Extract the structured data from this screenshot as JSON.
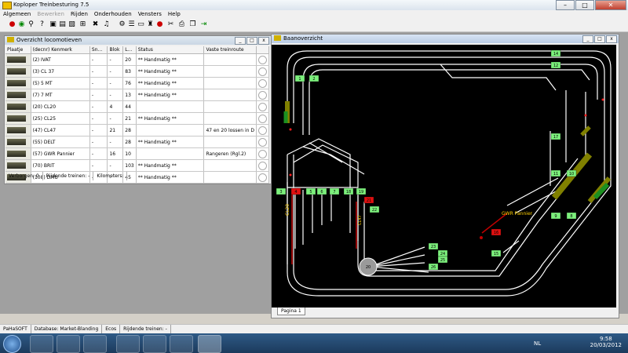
{
  "app": {
    "title": "Koploper Treinbesturing 7.5"
  },
  "menu": [
    "Algemeen",
    "Bewerken",
    "Rijden",
    "Onderhouden",
    "Vensters",
    "Help"
  ],
  "menu_disabled": [
    false,
    true,
    false,
    false,
    false,
    false
  ],
  "loco_panel": {
    "title": "Overzicht locomotieven",
    "columns": [
      "Plaatje",
      "(decnr) Kenmerk",
      "Sn...",
      "Blok",
      "L...",
      "Status",
      "Vaste treinroute"
    ],
    "rows": [
      {
        "kenmerk": "(2) IVAT",
        "sn": "-",
        "blok": "-",
        "l": "20",
        "status": "** Handmatig **",
        "route": ""
      },
      {
        "kenmerk": "(3) CL 37",
        "sn": "-",
        "blok": "-",
        "l": "83",
        "status": "** Handmatig **",
        "route": ""
      },
      {
        "kenmerk": "(5) 5 MT",
        "sn": "-",
        "blok": "-",
        "l": "76",
        "status": "** Handmatig **",
        "route": ""
      },
      {
        "kenmerk": "(7) 7 MT",
        "sn": "-",
        "blok": "-",
        "l": "13",
        "status": "** Handmatig **",
        "route": ""
      },
      {
        "kenmerk": "(20) CL20",
        "sn": "-",
        "blok": "4",
        "l": "44",
        "status": "",
        "route": ""
      },
      {
        "kenmerk": "(25) CL25",
        "sn": "-",
        "blok": "-",
        "l": "21",
        "status": "** Handmatig **",
        "route": ""
      },
      {
        "kenmerk": "(47) CL47",
        "sn": "-",
        "blok": "21",
        "l": "28",
        "status": "",
        "route": "47 en 20  lossen in D"
      },
      {
        "kenmerk": "(55) DELT",
        "sn": "-",
        "blok": "-",
        "l": "28",
        "status": "** Handmatig **",
        "route": ""
      },
      {
        "kenmerk": "(57) GWR Pannier",
        "sn": "-",
        "blok": "16",
        "l": "10",
        "status": "",
        "route": "Rangeren (Rgl.2)"
      },
      {
        "kenmerk": "(70) BRIT",
        "sn": "-",
        "blok": "-",
        "l": "103",
        "status": "** Handmatig **",
        "route": ""
      },
      {
        "kenmerk": "(108) DMU",
        "sn": "-",
        "blok": "-",
        "l": "45",
        "status": "** Handmatig **",
        "route": ""
      }
    ],
    "status": {
      "verborgen": "Verborgen: 0",
      "rijdend": "Rijdende treinen: -",
      "km": "Kilometers:"
    }
  },
  "track_panel": {
    "title": "Baanoverzicht",
    "tab": "Pagina 1",
    "labels": {
      "cl20": "CL20",
      "cl47": "CL47",
      "gwr": "GWR Pannier"
    },
    "blocks": [
      "14",
      "12",
      "1",
      "2",
      "17",
      "11",
      "10",
      "3",
      "4",
      "5",
      "6",
      "7",
      "18",
      "19",
      "21",
      "22",
      "9",
      "8",
      "16",
      "15",
      "23",
      "24",
      "25",
      "26",
      "20"
    ],
    "colors": {
      "free": "#7cf07c",
      "occupied": "#e01010",
      "background": "#000000",
      "track": "#ffffff"
    }
  },
  "statusbar": [
    "PaHaSOFT",
    "Database: Market-Blanding",
    "Ecos",
    "Rijdende treinen: -"
  ],
  "taskbar": {
    "lang": "NL",
    "time": "9:58",
    "date": "20/03/2012"
  }
}
